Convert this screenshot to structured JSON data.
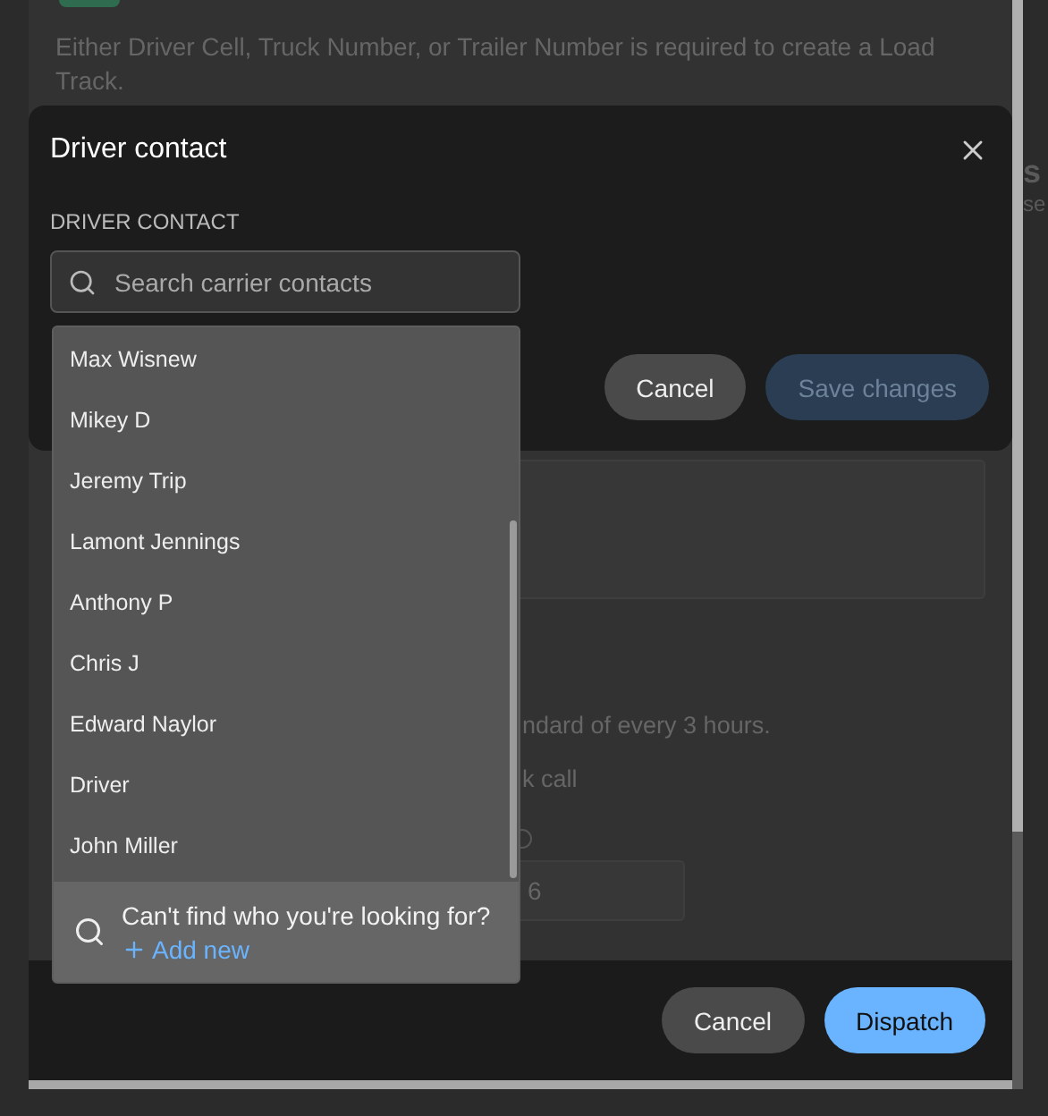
{
  "background": {
    "hint": "Either Driver Cell, Truck Number, or Trailer Number is required to create a Load Track.",
    "side_texts": [
      "s",
      "se"
    ],
    "schedule_text": "ndard of every 3 hours.",
    "option_text": "k call",
    "interval_input": {
      "value": "6"
    },
    "footer_buttons": [
      {
        "label": "Cancel",
        "kind": "secondary"
      },
      {
        "label": "Dispatch",
        "kind": "primary"
      }
    ]
  },
  "dialog": {
    "title": "Driver contact",
    "field_label": "DRIVER CONTACT",
    "search": {
      "placeholder": "Search carrier contacts"
    },
    "buttons": [
      {
        "label": "Cancel",
        "kind": "secondary"
      },
      {
        "label": "Save changes",
        "kind": "primary",
        "disabled": true
      }
    ]
  },
  "dropdown": {
    "contacts": [
      "Max Wisnew",
      "Mikey D",
      "Jeremy Trip",
      "Lamont Jennings",
      "Anthony P",
      "Chris J",
      "Edward Naylor",
      "Driver",
      "John Miller"
    ],
    "empty_prompt": "Can't find who you're looking for?",
    "add_link": "Add new"
  }
}
